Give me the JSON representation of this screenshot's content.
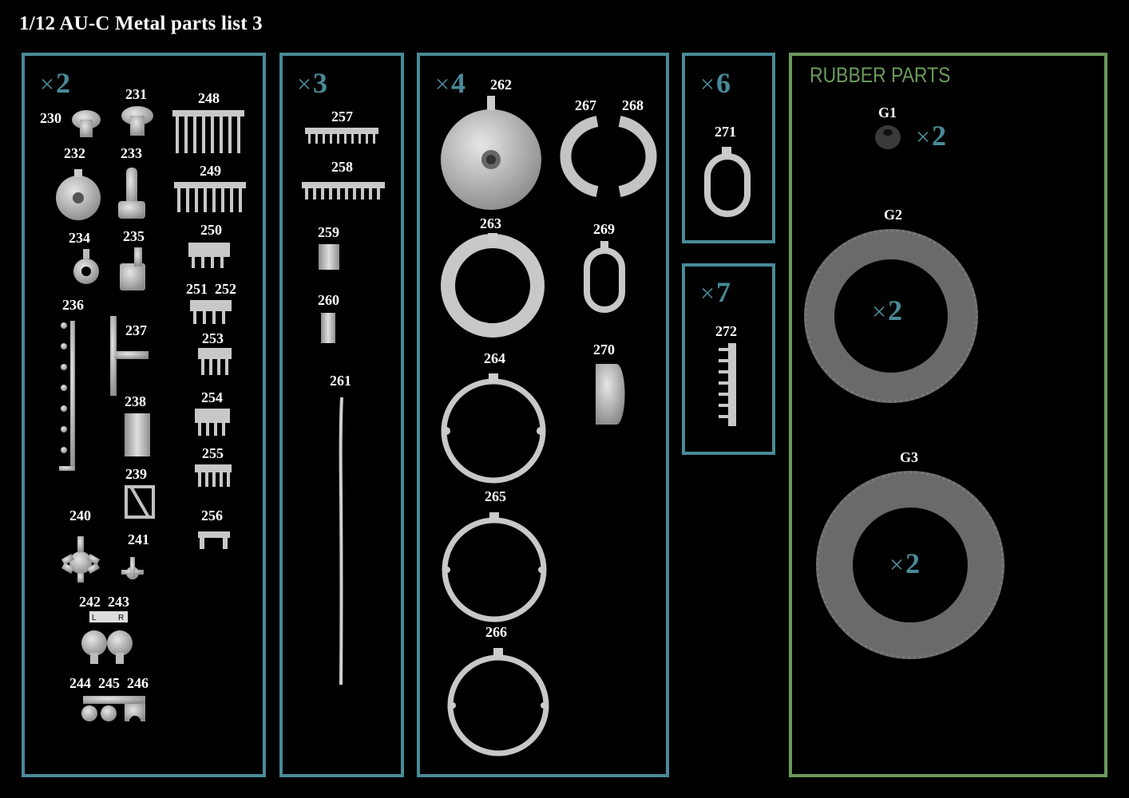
{
  "title": "1/12  AU-C  Metal parts list 3",
  "multiplier_symbol": "×",
  "colors": {
    "panel_border": "#4a8a98",
    "rubber_border": "#6a9a5a",
    "background": "#000000",
    "part_metal": "#bfbfbf",
    "part_rubber": "#6b6b6b"
  },
  "panels": {
    "x2": {
      "multiplier": "2"
    },
    "x3": {
      "multiplier": "3"
    },
    "x4": {
      "multiplier": "4"
    },
    "x6": {
      "multiplier": "6"
    },
    "x7": {
      "multiplier": "7"
    }
  },
  "labels": {
    "p230": "230",
    "p231": "231",
    "p232": "232",
    "p233": "233",
    "p234": "234",
    "p235": "235",
    "p236": "236",
    "p237": "237",
    "p238": "238",
    "p239": "239",
    "p240": "240",
    "p241": "241",
    "p242_243": "242  243",
    "p244_246": "244  245  246",
    "p248": "248",
    "p249": "249",
    "p250": "250",
    "p251_252": "251  252",
    "p253": "253",
    "p254": "254",
    "p255": "255",
    "p256": "256",
    "p257": "257",
    "p258": "258",
    "p259": "259",
    "p260": "260",
    "p261": "261",
    "p262": "262",
    "p263": "263",
    "p264": "264",
    "p265": "265",
    "p266": "266",
    "p267": "267",
    "p268": "268",
    "p269": "269",
    "p270": "270",
    "p271": "271",
    "p272": "272"
  },
  "rubber": {
    "heading": "RUBBER PARTS",
    "g1": {
      "label": "G1",
      "multiplier": "2"
    },
    "g2": {
      "label": "G2",
      "multiplier": "2"
    },
    "g3": {
      "label": "G3",
      "multiplier": "2"
    }
  }
}
